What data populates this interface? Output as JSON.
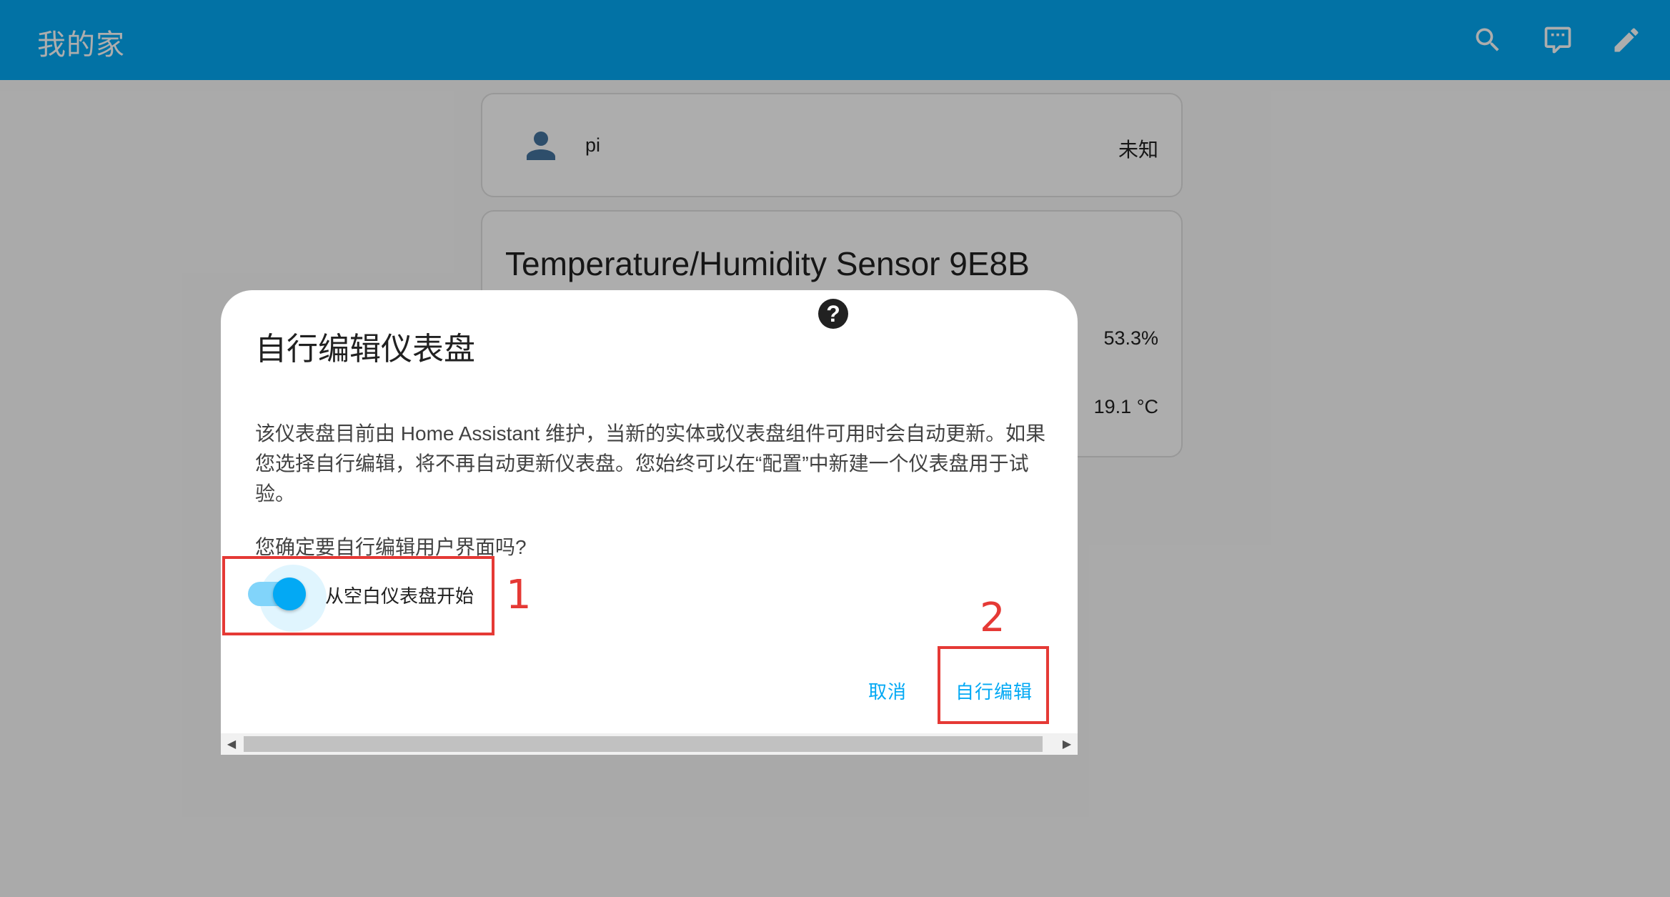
{
  "header": {
    "title": "我的家",
    "icons": [
      "search-icon",
      "chat-icon",
      "pencil-icon"
    ],
    "color": "#03a9f4"
  },
  "person_card": {
    "name": "pi",
    "state": "未知",
    "icon": "person-icon"
  },
  "sensor_card": {
    "title": "Temperature/Humidity Sensor 9E8B",
    "humidity": "53.3%",
    "temperature": "19.1 °C"
  },
  "dialog": {
    "title": "自行编辑仪表盘",
    "body": "该仪表盘目前由 Home Assistant 维护，当新的实体或仪表盘组件可用时会自动更新。如果您选择自行编辑，将不再自动更新仪表盘。您始终可以在“配置”中新建一个仪表盘用于试验。",
    "question": "您确定要自行编辑用户界面吗?",
    "toggle_label": "从空白仪表盘开始",
    "toggle_on": true,
    "cancel_label": "取消",
    "confirm_label": "自行编辑",
    "help_icon": "help-icon",
    "accent": "#03a9f4"
  },
  "annotations": {
    "num1": "1",
    "num2": "2",
    "color": "#e53935"
  }
}
